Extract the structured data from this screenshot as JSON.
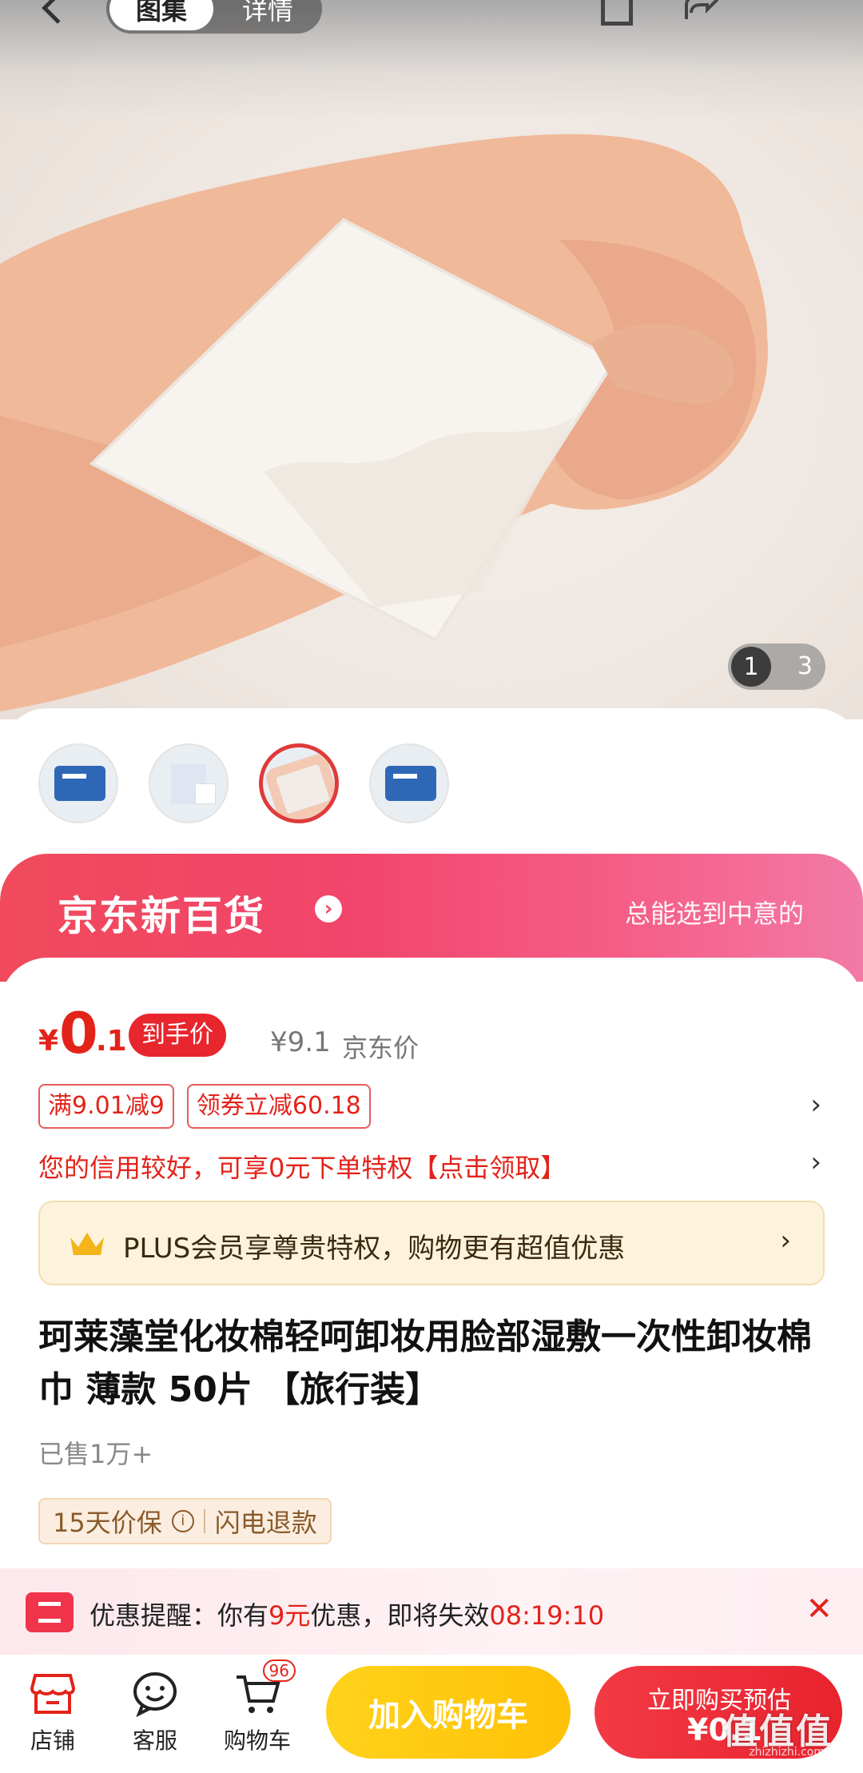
{
  "header": {
    "tab_active": "图集",
    "tab_inactive": "详情"
  },
  "gallery": {
    "current": "1",
    "total": "3",
    "thumbnail_count": 4,
    "selected_thumbnail": 3
  },
  "banner": {
    "brand": "京东新百货",
    "slogan": "总能选到中意的"
  },
  "price": {
    "currency": "¥",
    "integer": "0",
    "decimal": ".1",
    "tag": "到手价",
    "original": "¥9.1",
    "original_label": "京东价"
  },
  "coupons": [
    {
      "label": "满9.01减9"
    },
    {
      "label": "领券立减60.18"
    }
  ],
  "credit_notice": "您的信用较好，可享0元下单特权【点击领取】",
  "plus": {
    "text": "PLUS会员享尊贵特权，购物更有超值优惠"
  },
  "product": {
    "title": "珂莱藻堂化妆棉轻呵卸妆用脸部湿敷一次性卸妆棉巾 薄款 50片 【旅行装】",
    "sold": "已售1万+"
  },
  "guarantee": {
    "price_protect": "15天价保",
    "refund": "闪电退款"
  },
  "reminder": {
    "prefix": "优惠提醒：你有",
    "amount": "9元",
    "middle": "优惠，即将失效",
    "countdown": "08:19:10"
  },
  "bottom_nav": {
    "store": "店铺",
    "service": "客服",
    "cart": "购物车",
    "cart_badge": "96"
  },
  "buttons": {
    "add_to_cart": "加入购物车",
    "buy_now": "立即购买预估",
    "buy_price": "¥0.1"
  },
  "watermark": {
    "main": "值值值",
    "sub": "zhizhizhi.com"
  },
  "colors": {
    "accent_red": "#e2231a",
    "cart_yellow": "#ffc107",
    "plus_bg": "#fdf3dc"
  }
}
